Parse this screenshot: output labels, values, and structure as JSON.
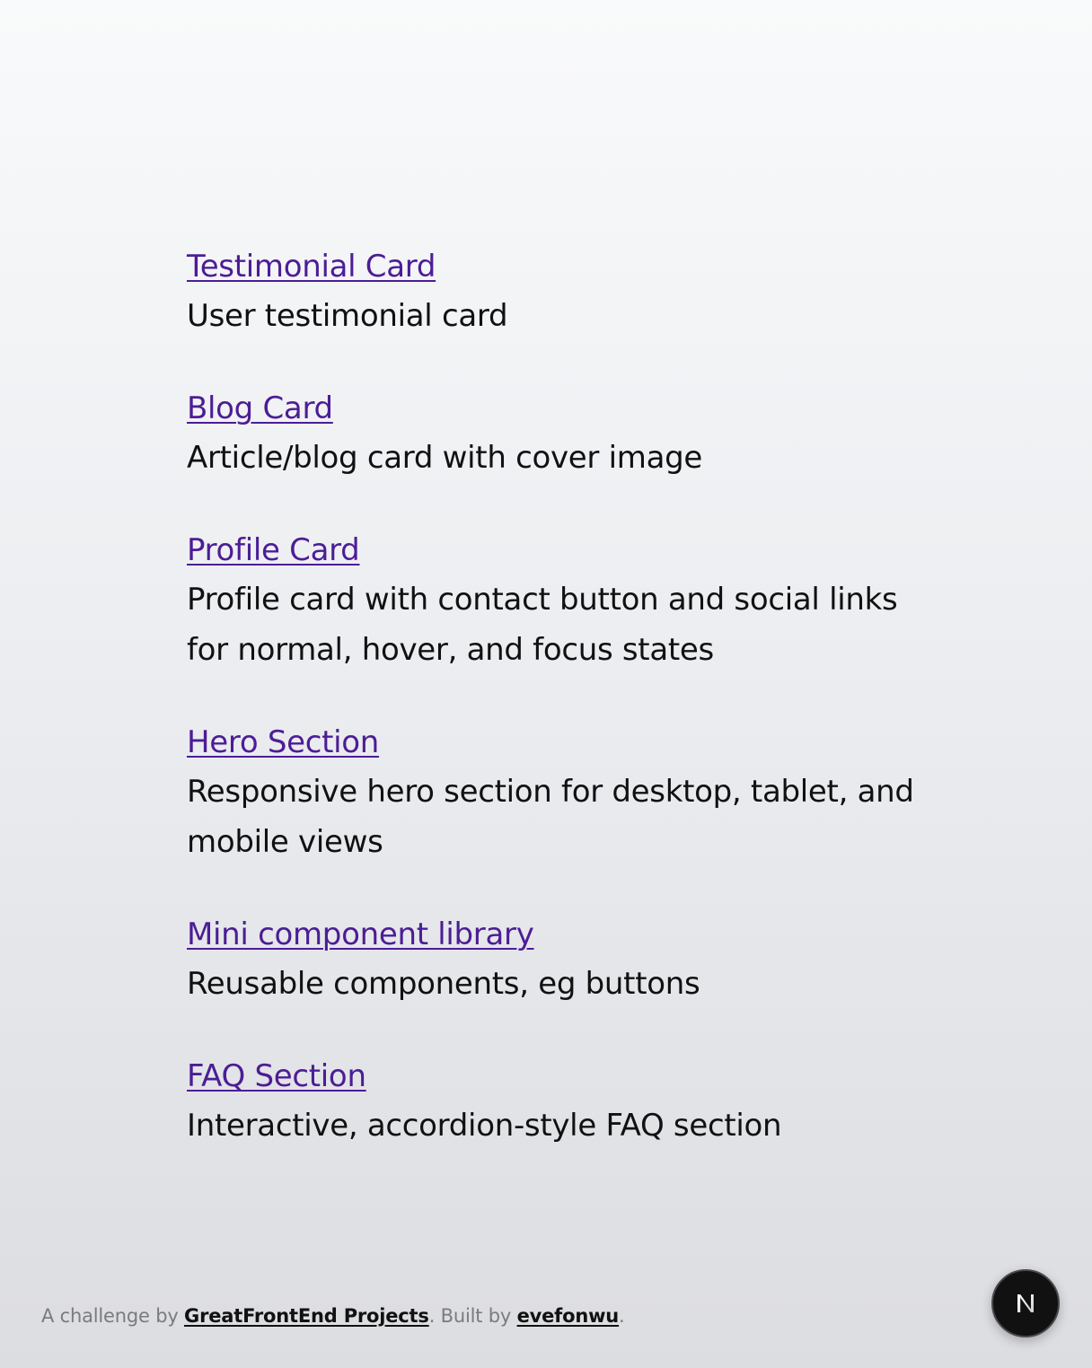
{
  "projects": [
    {
      "title": "Testimonial Card",
      "description": "User testimonial card"
    },
    {
      "title": "Blog Card",
      "description": "Article/blog card with cover image"
    },
    {
      "title": "Profile Card",
      "description": "Profile card with contact button and social links for normal, hover, and focus states"
    },
    {
      "title": "Hero Section",
      "description": "Responsive hero section for desktop, tablet, and mobile views"
    },
    {
      "title": "Mini component library",
      "description": "Reusable components, eg buttons"
    },
    {
      "title": "FAQ Section",
      "description": "Interactive, accordion-style FAQ section"
    }
  ],
  "footer": {
    "prefix": "A challenge by ",
    "challenge_link": "GreatFrontEnd Projects",
    "middle": ". Built by ",
    "author_link": "evefonwu",
    "suffix": "."
  },
  "badge": {
    "icon": "nextjs-logo-icon"
  },
  "colors": {
    "link": "#4c1d95",
    "text": "#111111",
    "muted": "#7a7b80",
    "badge_bg": "#111111"
  }
}
